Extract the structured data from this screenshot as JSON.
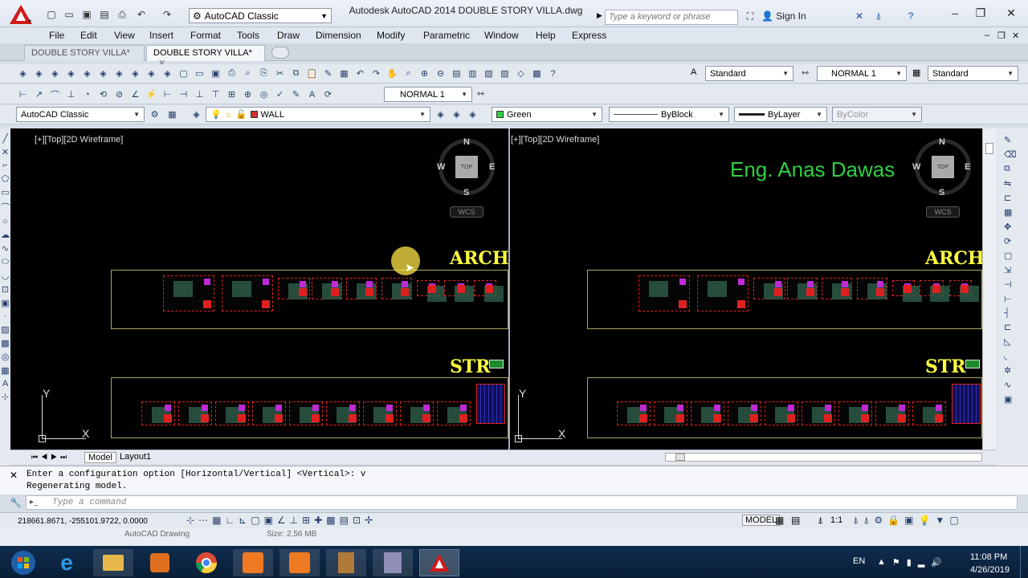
{
  "title_bar": {
    "workspace": "AutoCAD Classic",
    "app_title": "Autodesk AutoCAD 2014    DOUBLE STORY VILLA.dwg",
    "search_placeholder": "Type a keyword or phrase",
    "sign_in": "Sign In"
  },
  "menu": [
    "File",
    "Edit",
    "View",
    "Insert",
    "Format",
    "Tools",
    "Draw",
    "Dimension",
    "Modify",
    "Parametric",
    "Window",
    "Help",
    "Express"
  ],
  "file_tabs": [
    "DOUBLE STORY VILLA*",
    "DOUBLE STORY VILLA*"
  ],
  "styles": {
    "text_style": "Standard",
    "dim_style": "NORMAL 1",
    "table_style": "Standard",
    "multileader_style": "NORMAL 1"
  },
  "layers": {
    "workspace": "AutoCAD Classic",
    "current_layer": "WALL",
    "color": "Green",
    "linetype": "ByBlock",
    "lineweight": "ByLayer",
    "plotstyle": "ByColor"
  },
  "colors": {
    "layer_color": "#cc3333",
    "green": "#2ecf43",
    "arch": "#ffff40"
  },
  "viewports": [
    {
      "label": "[+][Top][2D Wireframe]",
      "view_cube_face": "TOP",
      "wcs": "WCS",
      "compass": {
        "n": "N",
        "s": "S",
        "e": "E",
        "w": "W"
      },
      "section_1": "ARCH",
      "section_2": "STR",
      "axis_x": "X",
      "axis_y": "Y"
    },
    {
      "label": "[+][Top][2D Wireframe]",
      "view_cube_face": "TOP",
      "wcs": "WCS",
      "compass": {
        "n": "N",
        "s": "S",
        "e": "E",
        "w": "W"
      },
      "section_1": "ARCH",
      "section_2": "STR",
      "axis_x": "X",
      "axis_y": "Y",
      "watermark": "Eng. Anas Dawas"
    }
  ],
  "layout_tabs": [
    "Model",
    "Layout1"
  ],
  "command_history": [
    "Enter a configuration option [Horizontal/Vertical] <Vertical>: v",
    "Regenerating model."
  ],
  "command_placeholder": "Type a command",
  "status": {
    "coordinates": "218661.8671, -255101.9722, 0.0000",
    "space": "MODEL",
    "scale": "1:1"
  },
  "behind": {
    "file_type": "AutoCAD Drawing",
    "size": "Size: 2.56 MB"
  },
  "taskbar": {
    "lang": "EN",
    "time": "11:08 PM",
    "date": "4/26/2019"
  }
}
